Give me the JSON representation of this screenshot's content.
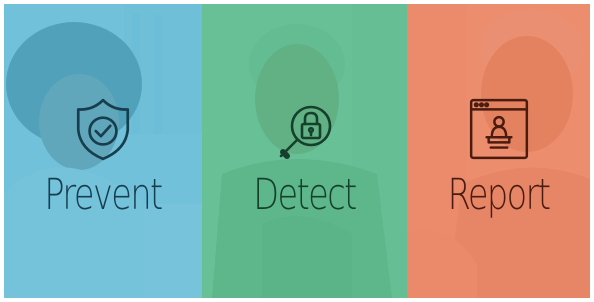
{
  "panels": [
    {
      "label": "Prevent",
      "icon": "shield-check-icon",
      "overlay_color": "#5bb8d6",
      "text_color": "#173e4e"
    },
    {
      "label": "Detect",
      "icon": "magnifier-lock-icon",
      "overlay_color": "#4eb786",
      "text_color": "#15402c"
    },
    {
      "label": "Report",
      "icon": "browser-report-icon",
      "overlay_color": "#ea7b58",
      "text_color": "#4a1c10"
    }
  ]
}
